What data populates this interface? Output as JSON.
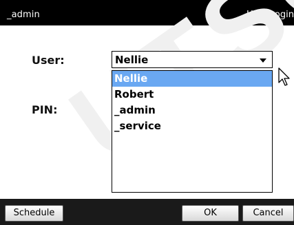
{
  "window": {
    "user_label": "_admin",
    "title": "User Login"
  },
  "form": {
    "user_label": "User:",
    "pin_label": "PIN:",
    "user_select": {
      "selected": "Nellie",
      "options": [
        "Nellie",
        "Robert",
        "_admin",
        "_service"
      ],
      "highlighted_index": 0
    }
  },
  "footer": {
    "schedule_label": "Schedule",
    "ok_label": "OK",
    "cancel_label": "Cancel"
  },
  "watermark": "UTSCH"
}
